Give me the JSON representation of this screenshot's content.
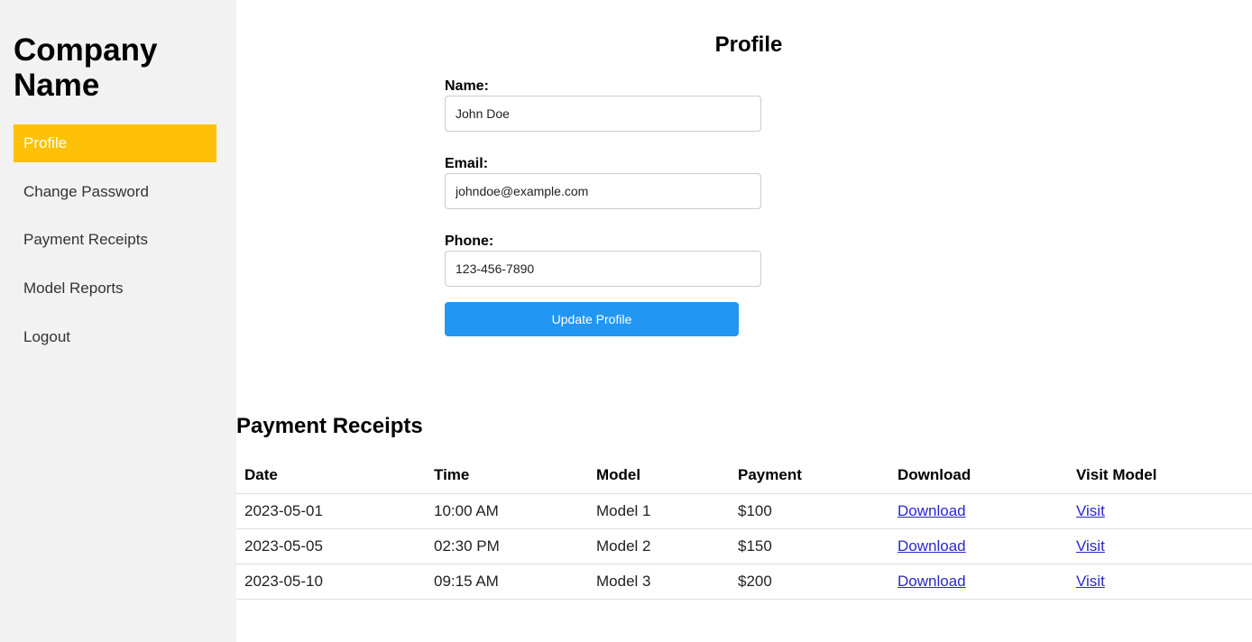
{
  "sidebar": {
    "brand": "Company Name",
    "items": [
      {
        "label": "Profile",
        "active": true
      },
      {
        "label": "Change Password",
        "active": false
      },
      {
        "label": "Payment Receipts",
        "active": false
      },
      {
        "label": "Model Reports",
        "active": false
      },
      {
        "label": "Logout",
        "active": false
      }
    ]
  },
  "profile": {
    "title": "Profile",
    "fields": [
      {
        "label": "Name:",
        "value": "John Doe"
      },
      {
        "label": "Email:",
        "value": "johndoe@example.com"
      },
      {
        "label": "Phone:",
        "value": "123-456-7890"
      }
    ],
    "submit_label": "Update Profile"
  },
  "receipts": {
    "title": "Payment Receipts",
    "columns": [
      "Date",
      "Time",
      "Model",
      "Payment",
      "Download",
      "Visit Model"
    ],
    "rows": [
      {
        "date": "2023-05-01",
        "time": "10:00 AM",
        "model": "Model 1",
        "payment": "$100",
        "download": "Download",
        "visit": "Visit"
      },
      {
        "date": "2023-05-05",
        "time": "02:30 PM",
        "model": "Model 2",
        "payment": "$150",
        "download": "Download",
        "visit": "Visit"
      },
      {
        "date": "2023-05-10",
        "time": "09:15 AM",
        "model": "Model 3",
        "payment": "$200",
        "download": "Download",
        "visit": "Visit"
      }
    ]
  },
  "colors": {
    "sidebar_bg": "#f2f2f2",
    "active_item_bg": "#ffc107",
    "button_bg": "#2196f3",
    "link": "#2a28c8"
  }
}
